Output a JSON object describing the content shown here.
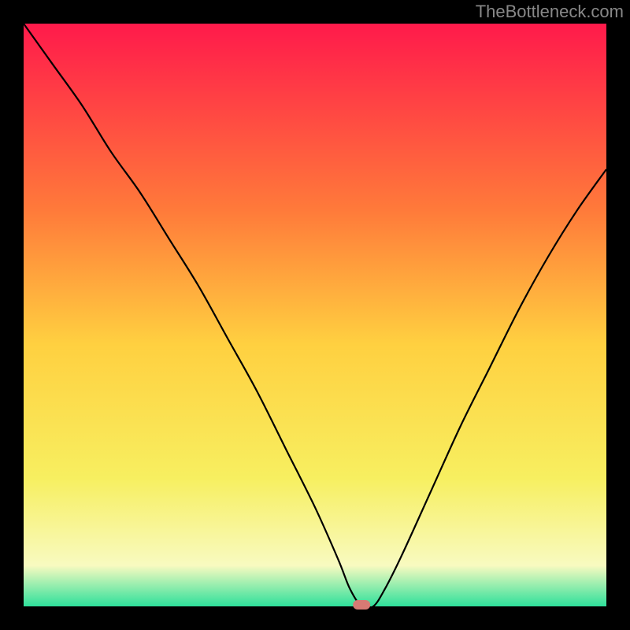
{
  "watermark": "TheBottleneck.com",
  "chart_data": {
    "type": "line",
    "title": "",
    "xlabel": "",
    "ylabel": "",
    "xlim": [
      0,
      100
    ],
    "ylim": [
      0,
      100
    ],
    "description": "Bottleneck percentage curve descending to a minimum near x≈58 then rising again, over a vertical red→yellow→green gradient background inside a black frame.",
    "x": [
      0,
      5,
      10,
      15,
      20,
      25,
      30,
      35,
      40,
      45,
      50,
      54,
      56,
      58,
      60,
      62,
      65,
      70,
      75,
      80,
      85,
      90,
      95,
      100
    ],
    "y": [
      100,
      93,
      86,
      78,
      71,
      63,
      55,
      46,
      37,
      27,
      17,
      8,
      3,
      0,
      0,
      3,
      9,
      20,
      31,
      41,
      51,
      60,
      68,
      75
    ],
    "minimum_marker": {
      "x": 58,
      "y": 0
    },
    "gradient_colors": {
      "top": "#ff1a4b",
      "mid_upper": "#ff7a3a",
      "mid": "#ffd040",
      "mid_lower": "#f7ef60",
      "near_bottom": "#f8fac0",
      "bottom": "#2ee09b"
    },
    "frame_color": "#000000"
  }
}
